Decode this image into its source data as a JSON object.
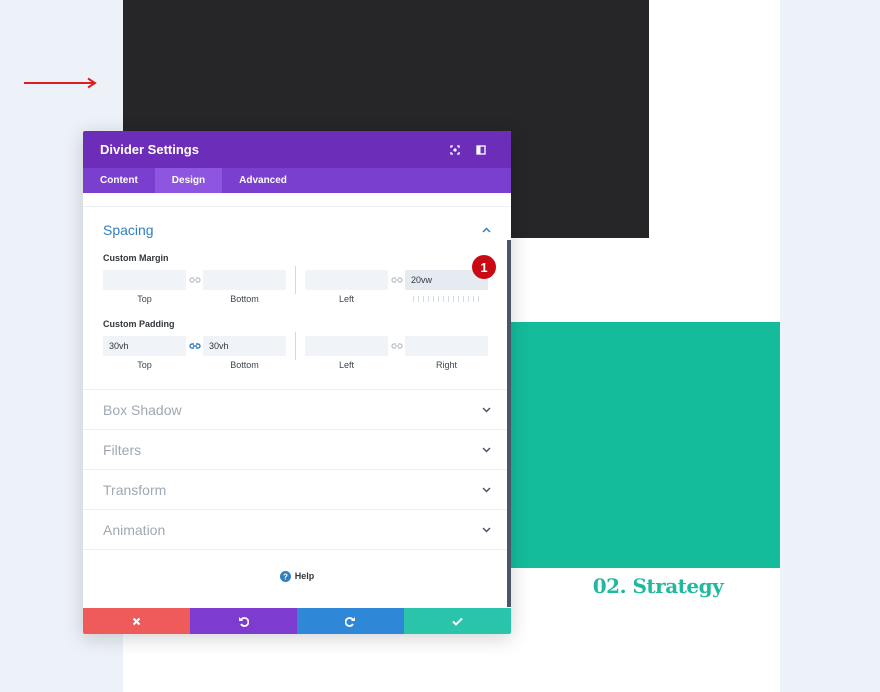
{
  "colors": {
    "modal_header": "#6c2eb9",
    "tabs_bar": "#7b3fd0",
    "active_tab": "#8e55e0",
    "teal_block": "#14bc9c",
    "dark_block": "#262628",
    "cancel": "#ef5b5b",
    "undo": "#7e3bd0",
    "redo": "#2f87d8",
    "save": "#29c4a9",
    "badge": "#c90a14",
    "arrow": "#dd1f1f"
  },
  "page": {
    "heading": "02. Strategy"
  },
  "modal": {
    "title": "Divider Settings",
    "header_icons": [
      "fullscreen-icon",
      "sidebar-toggle-icon"
    ],
    "tabs": [
      {
        "label": "Content",
        "active": false
      },
      {
        "label": "Design",
        "active": true
      },
      {
        "label": "Advanced",
        "active": false
      }
    ],
    "spacing": {
      "title": "Spacing",
      "custom_margin": {
        "label": "Custom Margin",
        "top": "",
        "bottom": "",
        "left": "",
        "right": "20vw",
        "captions": {
          "top": "Top",
          "bottom": "Bottom",
          "left": "Left"
        }
      },
      "custom_padding": {
        "label": "Custom Padding",
        "top": "30vh",
        "bottom": "30vh",
        "left": "",
        "right": "",
        "captions": {
          "top": "Top",
          "bottom": "Bottom",
          "left": "Left",
          "right": "Right"
        }
      },
      "badge": "1"
    },
    "sections": [
      "Box Shadow",
      "Filters",
      "Transform",
      "Animation"
    ],
    "help": "Help",
    "footer_icons": [
      "close-icon",
      "undo-icon",
      "redo-icon",
      "check-icon"
    ]
  }
}
